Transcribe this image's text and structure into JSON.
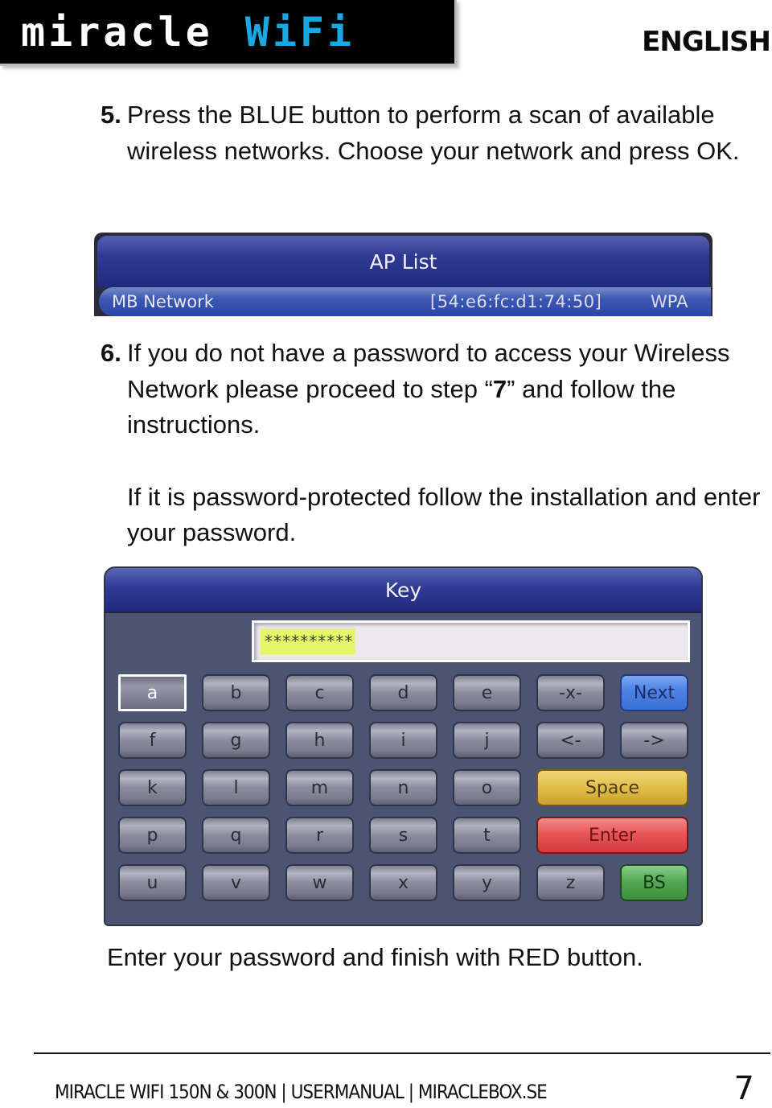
{
  "header": {
    "logo_word1": "miracle",
    "logo_word2": "WiFi",
    "language": "ENGLISH",
    "brand_accent": "#1aa8e3"
  },
  "steps": [
    {
      "number": "5.",
      "text": "Press the BLUE button to perform a scan of available wireless networks. Choose your network and press OK."
    },
    {
      "number": "6.",
      "text_before": "If you do not have a password to access your Wireless Network please proceed to step “",
      "text_bold": "7",
      "text_after": "” and follow the instructions.",
      "text_2": "If it is password-protected follow the installation and enter your password."
    }
  ],
  "ap_list": {
    "title": "AP List",
    "networks": [
      {
        "name": "MB Network",
        "mac": "[54:e6:fc:d1:74:50]",
        "security": "WPA"
      }
    ]
  },
  "key_dialog": {
    "title": "Key",
    "input_value": "**********",
    "rows": [
      [
        {
          "label": "a",
          "style": "selected"
        },
        {
          "label": "b"
        },
        {
          "label": "c"
        },
        {
          "label": "d"
        },
        {
          "label": "e"
        },
        {
          "label": "-x-"
        },
        {
          "label": "Next",
          "style": "blue"
        }
      ],
      [
        {
          "label": "f"
        },
        {
          "label": "g"
        },
        {
          "label": "h"
        },
        {
          "label": "i"
        },
        {
          "label": "j"
        },
        {
          "label": "<-"
        },
        {
          "label": "->"
        }
      ],
      [
        {
          "label": "k"
        },
        {
          "label": "l"
        },
        {
          "label": "m"
        },
        {
          "label": "n"
        },
        {
          "label": "o"
        },
        {
          "label": "Space",
          "style": "yellow"
        }
      ],
      [
        {
          "label": "p"
        },
        {
          "label": "q"
        },
        {
          "label": "r"
        },
        {
          "label": "s"
        },
        {
          "label": "t"
        },
        {
          "label": "Enter",
          "style": "red"
        }
      ],
      [
        {
          "label": "u"
        },
        {
          "label": "v"
        },
        {
          "label": "w"
        },
        {
          "label": "x"
        },
        {
          "label": "y"
        },
        {
          "label": "z"
        },
        {
          "label": "BS",
          "style": "green"
        }
      ]
    ]
  },
  "caption": "Enter your password and finish with RED button.",
  "footer": {
    "text": "MIRACLE WIFI 150N & 300N | USERMANUAL | MIRACLEBOX.SE",
    "page_number": "7"
  }
}
